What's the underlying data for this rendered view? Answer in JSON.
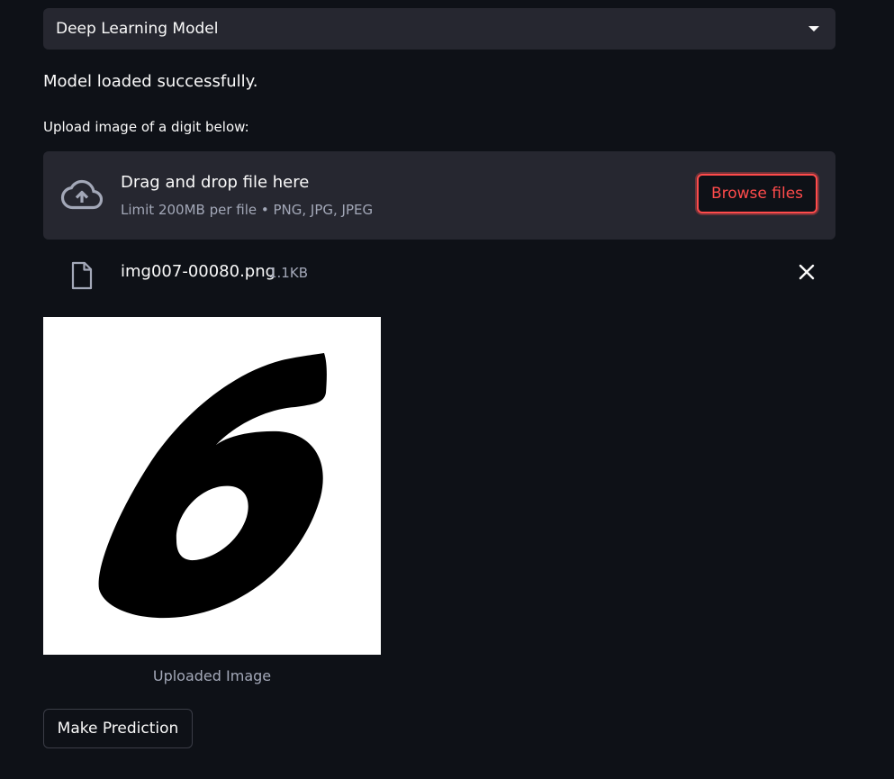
{
  "model_select": {
    "selected": "Deep Learning Model"
  },
  "status_message": "Model loaded successfully.",
  "upload": {
    "label": "Upload image of a digit below:",
    "dropzone_title": "Drag and drop file here",
    "dropzone_limit": "Limit 200MB per file • PNG, JPG, JPEG",
    "browse_label": "Browse files"
  },
  "file": {
    "name": "img007-00080.png",
    "size": "1.1KB"
  },
  "image": {
    "digit": "6",
    "caption": "Uploaded Image"
  },
  "actions": {
    "predict_label": "Make Prediction"
  },
  "colors": {
    "background": "#0e1117",
    "panel": "#262730",
    "accent": "#ff4b4b",
    "muted": "#a3a8b8"
  },
  "icons": [
    "chevron-down-icon",
    "cloud-upload-icon",
    "file-icon",
    "close-icon"
  ]
}
